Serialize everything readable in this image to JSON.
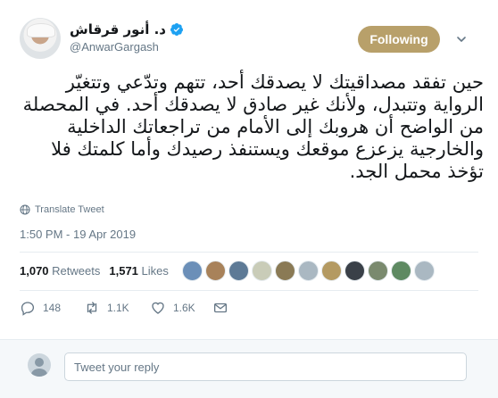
{
  "author": {
    "display_name": "د. أنور قرقاش",
    "handle": "@AnwarGargash",
    "verified": true
  },
  "follow_button": {
    "label": "Following",
    "color": "#b8a06a"
  },
  "tweet": {
    "text": "حين تفقد مصداقيتك لا يصدقك أحد، تتهم وتدّعي وتتغيّر الرواية وتتبدل، ولأنك غير صادق لا يصدقك أحد. في المحصلة من الواضح أن هروبك إلى الأمام من تراجعاتك الداخلية والخارجية يزعزع موقعك ويستنفذ رصيدك وأما كلمتك فلا تؤخذ محمل الجد.",
    "translate_label": "Translate Tweet",
    "timestamp": "1:50 PM - 19 Apr 2019"
  },
  "stats": {
    "retweets_count": "1,070",
    "retweets_label": "Retweets",
    "likes_count": "1,571",
    "likes_label": "Likes"
  },
  "liker_avatars": [
    "#6b8fb8",
    "#a8825a",
    "#5d7a96",
    "#c9ccb8",
    "#8a7a55",
    "#aab8c2",
    "#b49a62",
    "#3a4048",
    "#7a8a6e",
    "#5e8a62",
    "#aab8c2"
  ],
  "actions": {
    "replies": "148",
    "retweets": "1.1K",
    "likes": "1.6K"
  },
  "reply": {
    "placeholder": "Tweet your reply"
  },
  "icons": {
    "verified": "verified-badge-icon",
    "caret": "chevron-down-icon",
    "translate": "globe-icon",
    "reply": "reply-icon",
    "retweet": "retweet-icon",
    "like": "heart-icon",
    "message": "envelope-icon"
  },
  "colors": {
    "accent": "#1da1f2",
    "muted": "#657786",
    "text": "#14171a"
  }
}
